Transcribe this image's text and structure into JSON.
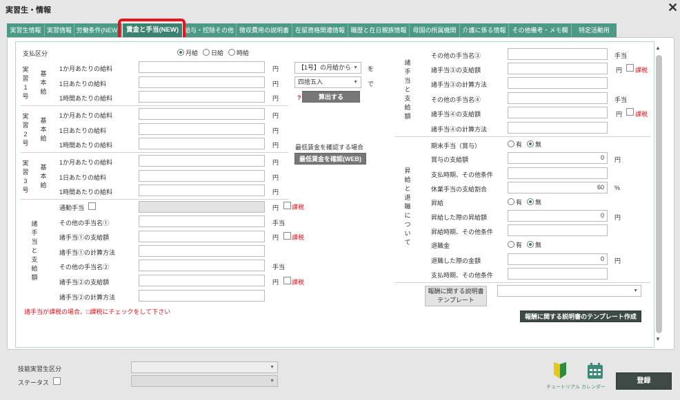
{
  "window": {
    "title": "実習生・情報",
    "close": "✕"
  },
  "tabs": [
    {
      "label": "実習生情報"
    },
    {
      "label": "実習情報"
    },
    {
      "label": "労働条件(NEW)"
    },
    {
      "label": "賃金と手当(NEW)"
    },
    {
      "label": "給与・控除その他"
    },
    {
      "label": "徴収費用の説明書"
    },
    {
      "label": "在留資格関連情報"
    },
    {
      "label": "職歴と在日親族情報"
    },
    {
      "label": "母国の所属機関"
    },
    {
      "label": "介護に係る情報"
    },
    {
      "label": "その他備考・メモ欄"
    },
    {
      "label": "特定活動用"
    }
  ],
  "pay": {
    "label": "支払区分",
    "options": [
      {
        "label": "月給",
        "checked": true
      },
      {
        "label": "日給",
        "checked": false
      },
      {
        "label": "時給",
        "checked": false
      }
    ]
  },
  "grades": [
    {
      "vlabel": "実習1号"
    },
    {
      "vlabel": "実習2号"
    },
    {
      "vlabel": "実習3号"
    }
  ],
  "base_label": "基本給",
  "rows": [
    "1か月あたりの給料",
    "1日あたりの給料",
    "1時間あたりの給料"
  ],
  "unit_yen": "円",
  "unit_teate": "手当",
  "unit_pct": "%",
  "tax_label": "課税",
  "calc": {
    "select1": "【1号】の月給から",
    "wo": "を",
    "select2": "四捨五入",
    "de": "で",
    "help": "?",
    "button": "算出する"
  },
  "minwage": {
    "label": "最低賃金を確認する場合",
    "button": "最低賃金を確認(WEB)"
  },
  "allow_left": {
    "vlabel": "諸手当と支給額",
    "commute": "通勤手当",
    "items": [
      "その他の手当名①",
      "諸手当①の支給額",
      "諸手当①の計算方法",
      "その他の手当名②",
      "諸手当②の支給額",
      "諸手当②の計算方法"
    ],
    "note": "諸手当が課税の場合、□課税にチェックをして下さい"
  },
  "allow_right": {
    "vlabel": "諸手当と支給額",
    "items": [
      "その他の手当名③",
      "諸手当③の支給額",
      "諸手当③の計算方法",
      "その他の手当名④",
      "諸手当④の支給額",
      "諸手当④の計算方法"
    ]
  },
  "raise": {
    "vlabel": "昇給と退職について",
    "bonus": "期末手当（賞与）",
    "bonus_amount": "賞与の支給額",
    "bonus_amount_value": "0",
    "bonus_timing": "支払時期、その他条件",
    "leave_rate": "休業手当の支給割合",
    "leave_rate_value": "60",
    "raise": "昇給",
    "raise_amount": "昇給した際の昇給額",
    "raise_amount_value": "0",
    "raise_timing": "昇給時期、その他条件",
    "retire": "退職金",
    "retire_amount": "退職した際の金額",
    "retire_amount_value": "0",
    "retire_timing": "支払時期、その他条件",
    "yes": "有",
    "no": "無"
  },
  "template": {
    "label": "報酬に関する説明書テンプレート",
    "button": "報酬に関する説明書のテンプレート作成"
  },
  "footer": {
    "kubun": "技能実習生区分",
    "status": "ステータス",
    "tutorial": "チュートリアル",
    "calendar": "カレンダー",
    "register": "登録"
  },
  "colors": {
    "tab": "#4d9987",
    "tab_active": "#3b8271",
    "highlight": "#e8141c",
    "button_dark": "#3e4a45"
  }
}
